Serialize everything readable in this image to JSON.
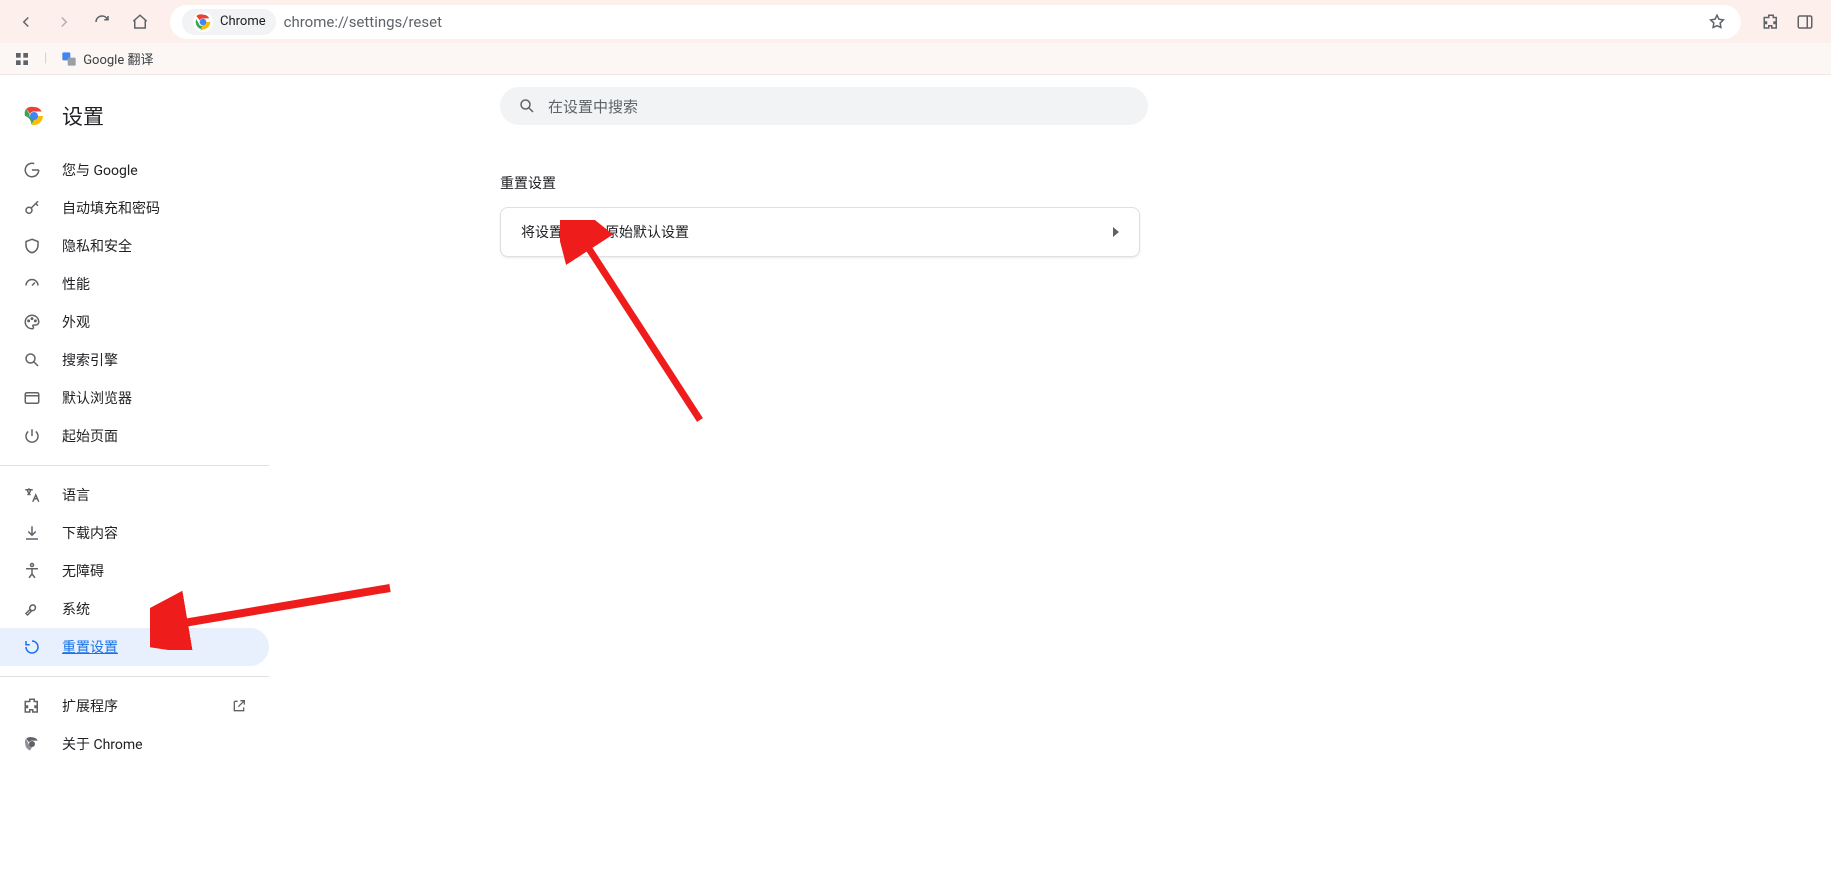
{
  "browser": {
    "address_chip_label": "Chrome",
    "url": "chrome://settings/reset"
  },
  "bookmarks": {
    "google_translate": "Google 翻译"
  },
  "settings": {
    "title": "设置",
    "search_placeholder": "在设置中搜索"
  },
  "sidebar": {
    "you_and_google": "您与 Google",
    "autofill": "自动填充和密码",
    "privacy": "隐私和安全",
    "performance": "性能",
    "appearance": "外观",
    "search_engine": "搜索引擎",
    "default_browser": "默认浏览器",
    "on_startup": "起始页面",
    "languages": "语言",
    "downloads": "下载内容",
    "accessibility": "无障碍",
    "system": "系统",
    "reset": "重置设置",
    "extensions": "扩展程序",
    "about": "关于 Chrome"
  },
  "main": {
    "section_title": "重置设置",
    "restore_defaults": "将设置还原为原始默认设置"
  }
}
